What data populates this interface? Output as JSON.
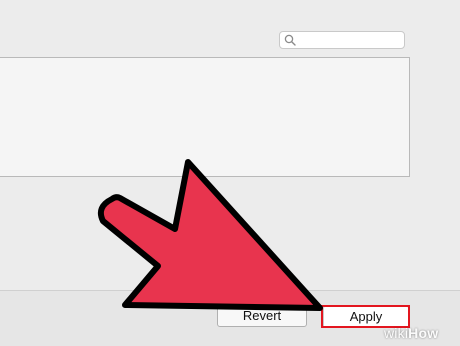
{
  "search": {
    "value": "",
    "placeholder": ""
  },
  "icons": {
    "search": "search-icon",
    "annotation": "pointer-arrow"
  },
  "buttons": {
    "revert_label": "Revert",
    "apply_label": "Apply"
  },
  "colors": {
    "arrow_fill": "#e8344e",
    "arrow_outline": "#000000",
    "highlight": "#e3161f"
  },
  "watermark": {
    "part1": "wiki",
    "part2": "How"
  }
}
